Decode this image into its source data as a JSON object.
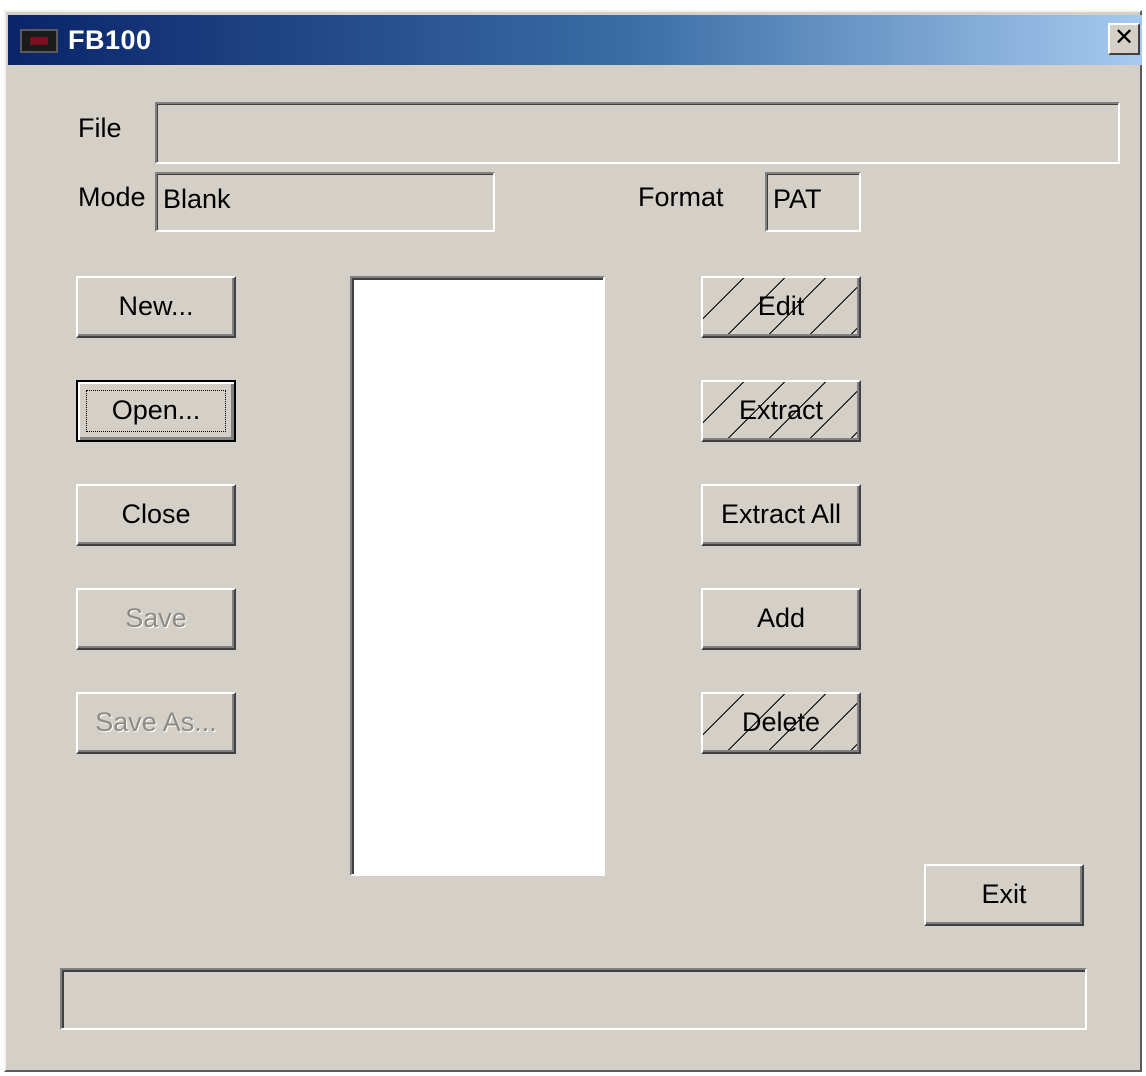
{
  "window": {
    "title": "FB100",
    "close_glyph": "✕"
  },
  "fields": {
    "file_label": "File",
    "file_value": "",
    "mode_label": "Mode",
    "mode_value": "Blank",
    "format_label": "Format",
    "format_value": "PAT"
  },
  "left_buttons": {
    "new": "New...",
    "open": "Open...",
    "close": "Close",
    "save": "Save",
    "save_as": "Save As..."
  },
  "right_buttons": {
    "edit": "Edit",
    "extract": "Extract",
    "extract_all": "Extract All",
    "add": "Add",
    "delete": "Delete"
  },
  "exit_button": "Exit",
  "list_items": [],
  "status_text": "",
  "colors": {
    "face": "#d4d0c8",
    "title_start": "#0a246a",
    "title_end": "#a6caf0",
    "disabled_text": "#8d8b86"
  },
  "icons": {
    "app": "app-icon",
    "close": "close-icon"
  }
}
